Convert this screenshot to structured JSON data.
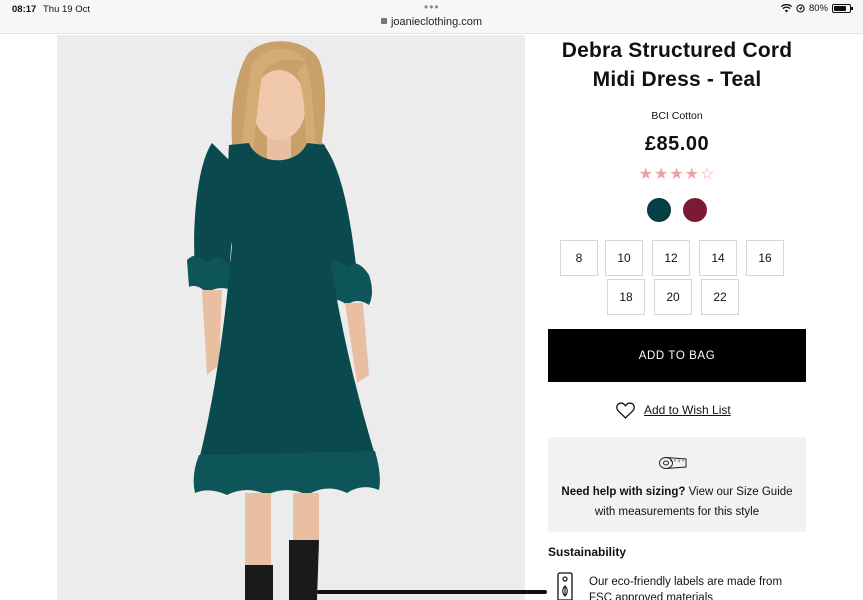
{
  "status_bar": {
    "time": "08:17",
    "date": "Thu 19 Oct",
    "url": "joanieclothing.com",
    "battery": "80%",
    "icons": [
      "wifi-icon",
      "location-icon",
      "battery-icon"
    ]
  },
  "product": {
    "image_subject": "woman-in-teal-dress",
    "title": "Debra Structured Cord Midi Dress - Teal",
    "fabric": "BCI Cotton",
    "price": "£85.00",
    "rating": {
      "stars": 4,
      "max": 5
    },
    "colours": [
      {
        "name": "teal",
        "hex": "#063f44",
        "selected": true
      },
      {
        "name": "wine",
        "hex": "#7a1a34",
        "selected": false
      }
    ],
    "sizes": [
      "8",
      "10",
      "12",
      "14",
      "16",
      "18",
      "20",
      "22"
    ]
  },
  "actions": {
    "add_to_bag": "ADD TO BAG",
    "wishlist": "Add to Wish List"
  },
  "sizing_help": {
    "bold": "Need help with sizing?",
    "text": " View our Size Guide with measurements for this style"
  },
  "sustainability": {
    "heading": "Sustainability",
    "text": "Our eco-friendly labels are made from FSC approved materials"
  },
  "colors": {
    "accent_black": "#000000",
    "star_pink": "#efa2a2",
    "panel_grey": "#f2f2f2"
  }
}
